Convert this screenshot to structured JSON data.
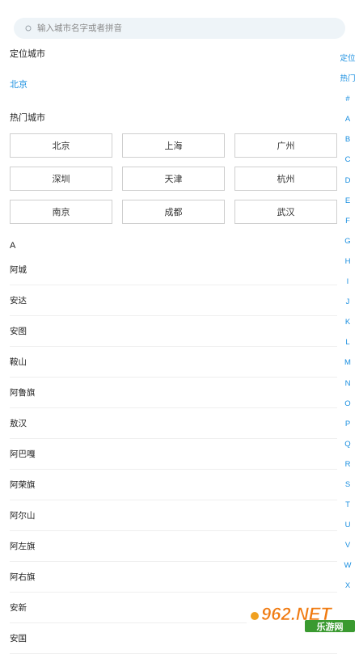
{
  "search": {
    "placeholder": "输入城市名字或者拼音"
  },
  "location": {
    "title": "定位城市",
    "city": "北京"
  },
  "hot": {
    "title": "热门城市",
    "cities": [
      "北京",
      "上海",
      "广州",
      "深圳",
      "天津",
      "杭州",
      "南京",
      "成都",
      "武汉"
    ]
  },
  "list": {
    "letter": "A",
    "cities": [
      "阿城",
      "安达",
      "安图",
      "鞍山",
      "阿鲁旗",
      "敖汉",
      "阿巴嘎",
      "阿荣旗",
      "阿尔山",
      "阿左旗",
      "阿右旗",
      "安新",
      "安国"
    ]
  },
  "index": [
    "定位",
    "热门",
    "#",
    "A",
    "B",
    "C",
    "D",
    "E",
    "F",
    "G",
    "H",
    "I",
    "J",
    "K",
    "L",
    "M",
    "N",
    "O",
    "P",
    "Q",
    "R",
    "S",
    "T",
    "U",
    "V",
    "W",
    "X"
  ],
  "watermark": {
    "text": "962.NET",
    "sub": "乐游网"
  },
  "colors": {
    "accent": "#1a8fe0",
    "search_bg": "#eef4f8",
    "border": "#cfcfcf"
  }
}
